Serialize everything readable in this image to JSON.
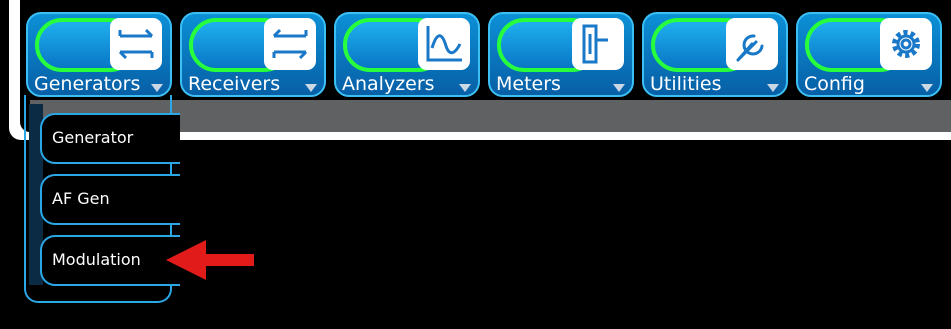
{
  "nav": {
    "tabs": [
      {
        "label": "Generators",
        "icon": "generators-icon"
      },
      {
        "label": "Receivers",
        "icon": "receivers-icon"
      },
      {
        "label": "Analyzers",
        "icon": "analyzers-icon"
      },
      {
        "label": "Meters",
        "icon": "meters-icon"
      },
      {
        "label": "Utilities",
        "icon": "wrench-icon"
      },
      {
        "label": "Config",
        "icon": "gear-icon"
      }
    ]
  },
  "dropdown": {
    "items": [
      {
        "label": "Generator"
      },
      {
        "label": "AF Gen"
      },
      {
        "label": "Modulation"
      }
    ]
  },
  "colors": {
    "tab_blue": "#0c90d6",
    "tab_border": "#3cc0f4",
    "active_green": "#27ff3d",
    "annotation_arrow": "#e11a1a"
  }
}
